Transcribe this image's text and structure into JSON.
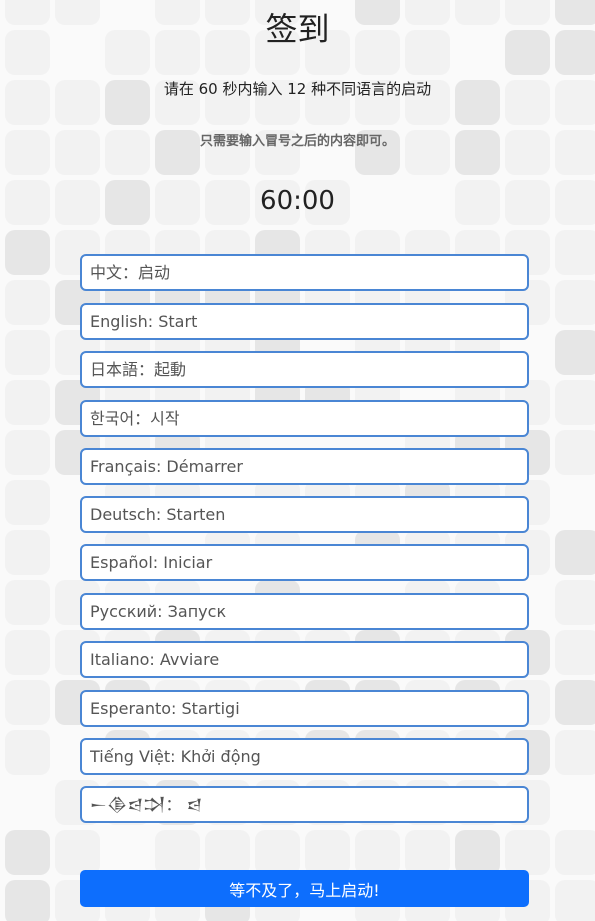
{
  "header": {
    "title": "签到",
    "instruction": "请在 60 秒内输入 12 种不同语言的启动",
    "hint": "只需要输入冒号之后的内容即可。",
    "timer": "60:00"
  },
  "form": {
    "fields": [
      {
        "placeholder": "中文：启动"
      },
      {
        "placeholder": "English: Start"
      },
      {
        "placeholder": "日本語：起動"
      },
      {
        "placeholder": "한국어：시작"
      },
      {
        "placeholder": "Français: Démarrer"
      },
      {
        "placeholder": "Deutsch: Starten"
      },
      {
        "placeholder": "Español: Iniciar"
      },
      {
        "placeholder": "Русский: Запуск"
      },
      {
        "placeholder": "Italiano: Avviare"
      },
      {
        "placeholder": "Esperanto: Startigi"
      },
      {
        "placeholder": "Tiếng Việt: Khởi động"
      },
      {
        "placeholder": "𒀸𒆠𒁀𒋫： 𒁀"
      }
    ],
    "submit_label": "等不及了，马上启动!"
  },
  "colors": {
    "input_border": "#4a86d4",
    "button_bg": "#0d6efd",
    "tile_light": "#f2f2f2",
    "tile_dark": "#e6e6e6"
  }
}
